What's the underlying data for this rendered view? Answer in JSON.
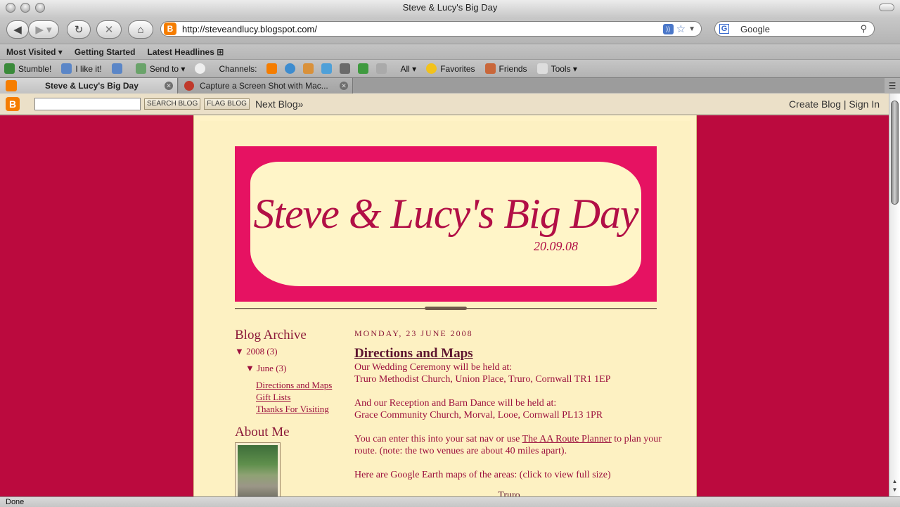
{
  "window": {
    "title": "Steve & Lucy's Big Day"
  },
  "nav": {
    "url": "http://steveandlucy.blogspot.com/",
    "search_placeholder": "Google",
    "favicon_letter": "B",
    "search_engine_letter": "G"
  },
  "bookmarks": [
    "Most Visited ▾",
    "Getting Started",
    "Latest Headlines ⊞"
  ],
  "toolbar": {
    "stumble": "Stumble!",
    "like": "I like it!",
    "send_to": "Send to ▾",
    "channels": "Channels:",
    "all": "All ▾",
    "favorites": "Favorites",
    "friends": "Friends",
    "tools": "Tools ▾"
  },
  "tabs": [
    {
      "label": "Steve & Lucy's Big Day"
    },
    {
      "label": "Capture a Screen Shot with Mac..."
    }
  ],
  "blogger_bar": {
    "search_button": "SEARCH BLOG",
    "flag_button": "FLAG BLOG",
    "next_blog": "Next Blog»",
    "create_blog": "Create Blog",
    "separator": "|",
    "sign_in": "Sign In"
  },
  "blog": {
    "header_title": "Steve & Lucy's Big Day",
    "header_date": "20.09.08",
    "archive_title": "Blog Archive",
    "year": "▼ 2008 (3)",
    "month": "▼ June (3)",
    "posts": [
      "Directions and Maps",
      "Gift Lists",
      "Thanks For Visiting"
    ],
    "about_title": "About Me",
    "post_date": "Monday, 23 June 2008",
    "post_title": "Directions and Maps",
    "line1": "Our Wedding Ceremony will be held at:",
    "line2": "Truro Methodist Church, Union Place, Truro, Cornwall TR1 1EP",
    "line3": "And our Reception and Barn Dance will be held at:",
    "line4": "Grace Community Church, Morval, Looe, Cornwall PL13 1PR",
    "line5_pre": "You can enter this into your sat nav or use ",
    "line5_link": "The AA Route Planner",
    "line5_post": " to plan your route. (note: the two venues are about 40 miles apart).",
    "line6": "Here are Google Earth maps of the areas: (click to view full size)",
    "map_label": "Truro"
  },
  "status": {
    "text": "Done"
  },
  "colors": {
    "page_bg": "#bb0a3e",
    "accent": "#e61262",
    "text": "#9c0f3d"
  }
}
